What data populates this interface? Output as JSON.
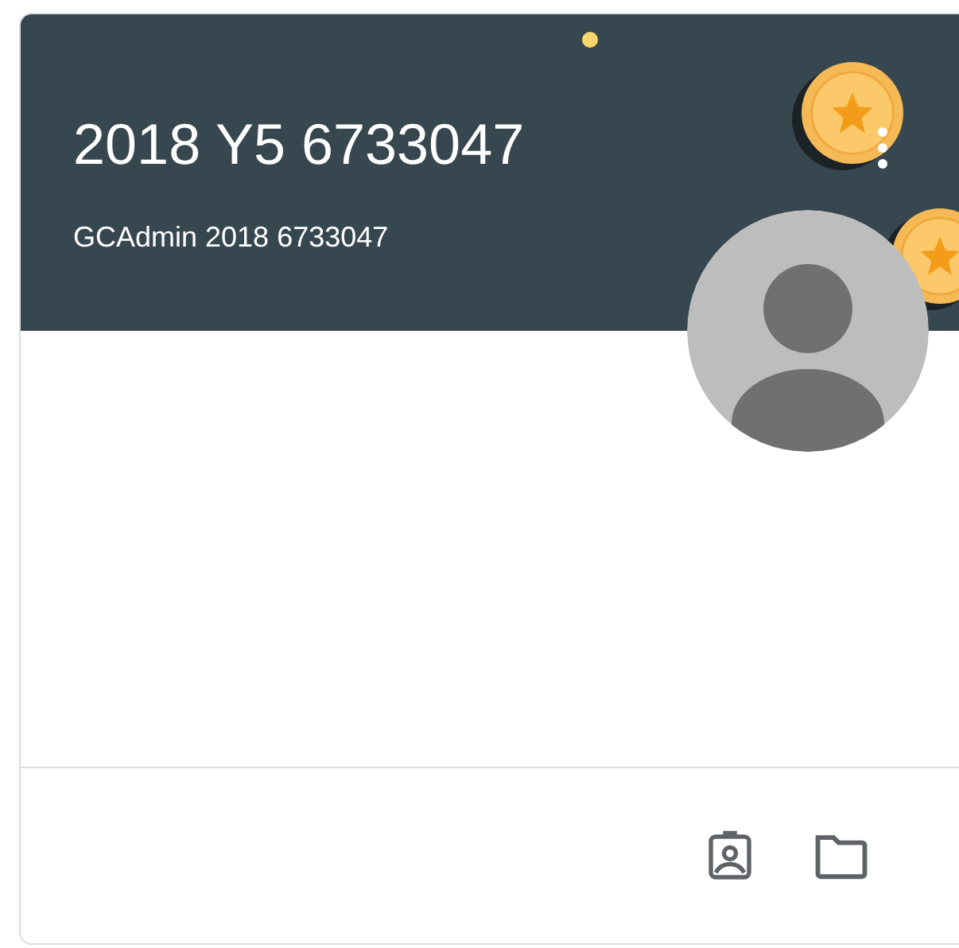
{
  "card": {
    "title": "2018 Y5 6733047",
    "subtitle": "GCAdmin 2018 6733047"
  }
}
